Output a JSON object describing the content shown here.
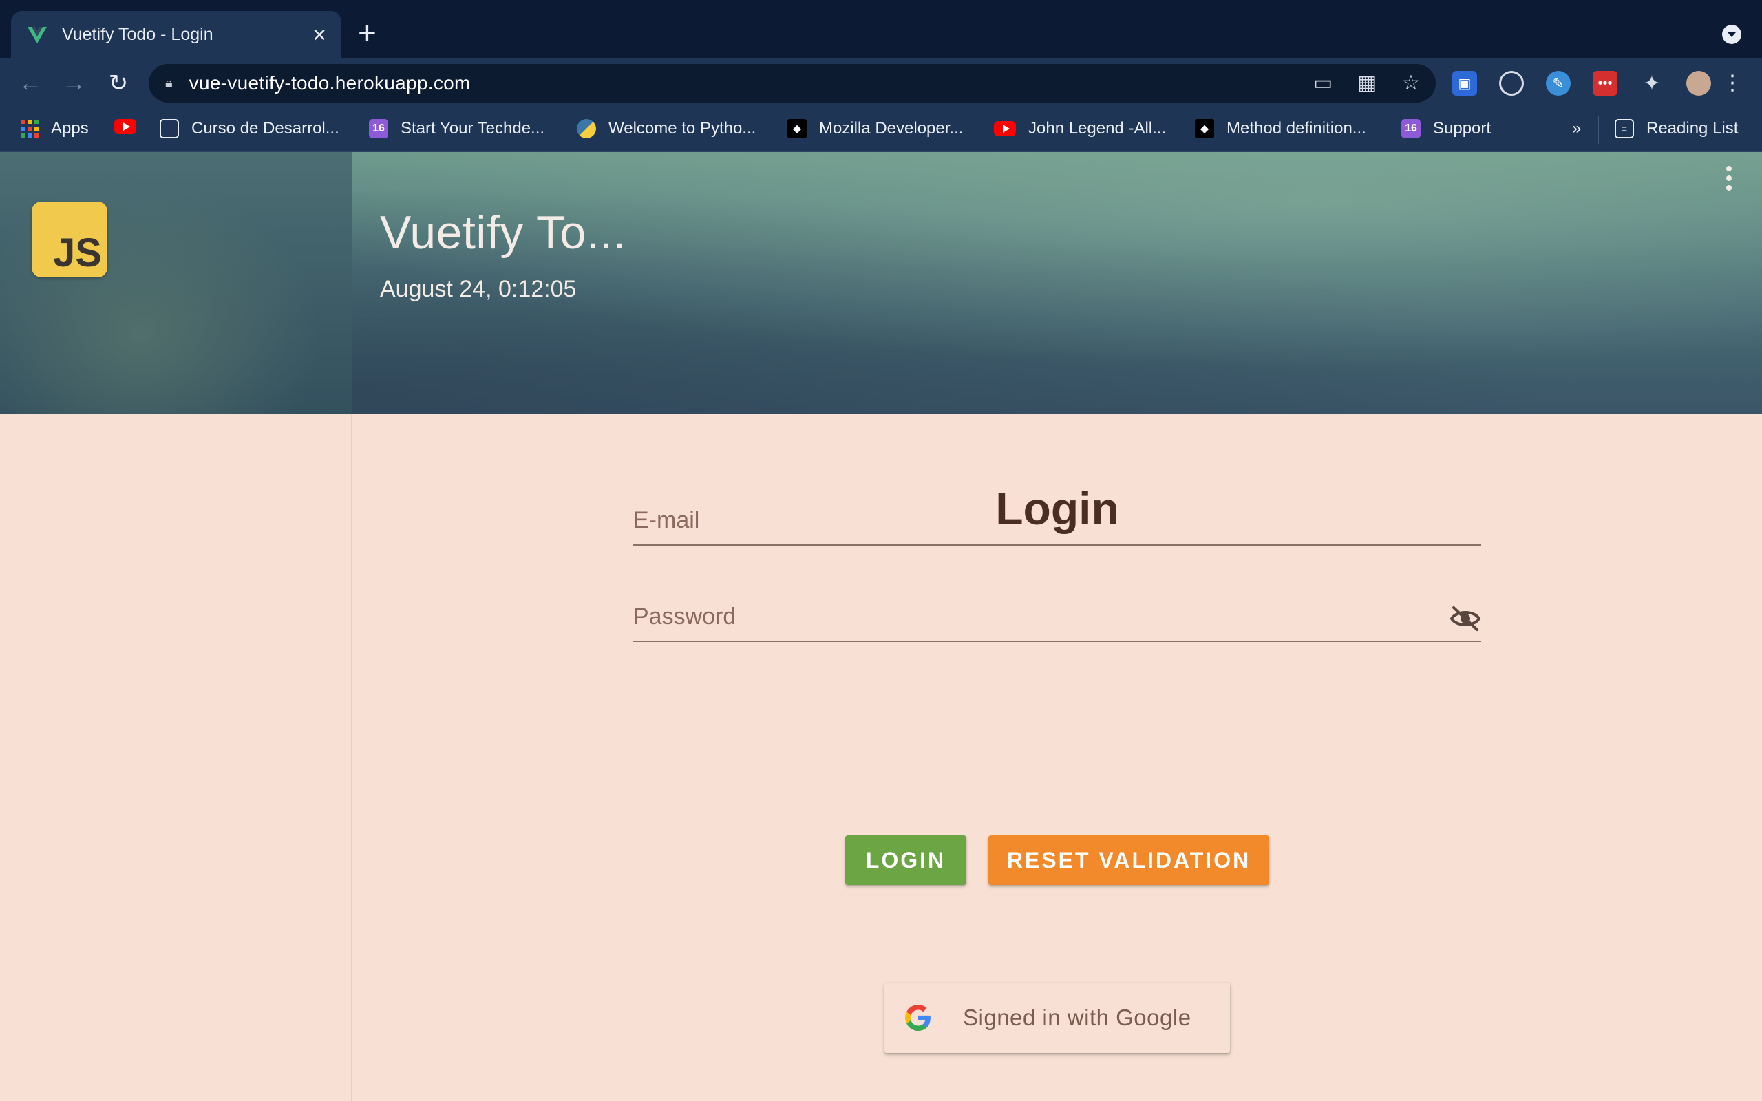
{
  "browser": {
    "tab_title": "Vuetify Todo - Login",
    "url": "vue-vuetify-todo.herokuapp.com",
    "bookmarks": [
      {
        "label": "Apps",
        "icon": "apps-grid-icon"
      },
      {
        "label": "",
        "icon": "youtube-icon"
      },
      {
        "label": "Curso de Desarrol...",
        "icon": "course-icon"
      },
      {
        "label": "Start Your Techde...",
        "icon": "badge-16-icon"
      },
      {
        "label": "Welcome to Pytho...",
        "icon": "python-icon"
      },
      {
        "label": "Mozilla Developer...",
        "icon": "mdn-icon"
      },
      {
        "label": "John Legend -All...",
        "icon": "youtube-icon"
      },
      {
        "label": "Method definition...",
        "icon": "mdn-icon"
      },
      {
        "label": "Support",
        "icon": "badge-16-icon"
      }
    ],
    "bookmarks_overflow": "»",
    "reading_list": "Reading List"
  },
  "app": {
    "logo_text": "JS",
    "title": "Vuetify To...",
    "datetime": "August 24, 0:12:05"
  },
  "login": {
    "heading": "Login",
    "email_placeholder": "E-mail",
    "email_value": "",
    "password_placeholder": "Password",
    "password_value": "",
    "login_button": "LOGIN",
    "reset_button": "RESET VALIDATION",
    "google_button": "Signed in with Google"
  },
  "colors": {
    "background": "#f8e1d4",
    "login_button": "#6ca544",
    "reset_button": "#f28a2b",
    "heading_text": "#4a2e22",
    "js_logo": "#f0c94d"
  }
}
